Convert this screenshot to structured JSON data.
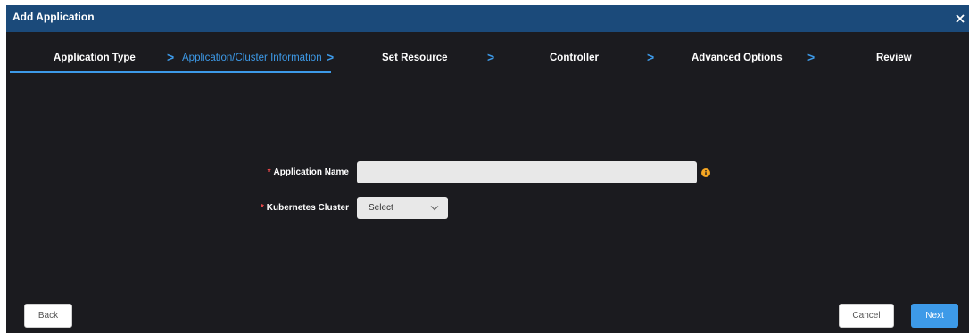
{
  "dialog": {
    "title": "Add Application",
    "close_icon": "close-icon"
  },
  "steps": [
    {
      "label": "Application Type",
      "state": "done"
    },
    {
      "label": "Application/Cluster Information",
      "state": "active"
    },
    {
      "label": "Set Resource",
      "state": "pending"
    },
    {
      "label": "Controller",
      "state": "pending"
    },
    {
      "label": "Advanced Options",
      "state": "pending"
    },
    {
      "label": "Review",
      "state": "pending"
    }
  ],
  "separator": ">",
  "form": {
    "required_mark": "*",
    "app_name": {
      "label": "Application Name",
      "value": "",
      "placeholder": "",
      "info_icon": "info-icon"
    },
    "cluster": {
      "label": "Kubernetes Cluster",
      "selected": "Select",
      "chevron_icon": "chevron-down-icon"
    }
  },
  "buttons": {
    "back": "Back",
    "cancel": "Cancel",
    "next": "Next"
  },
  "colors": {
    "titlebar": "#1b4a7a",
    "background": "#1b1b1f",
    "accent": "#3d9ae8",
    "required": "#ff4d4f",
    "info": "#f5a623"
  }
}
